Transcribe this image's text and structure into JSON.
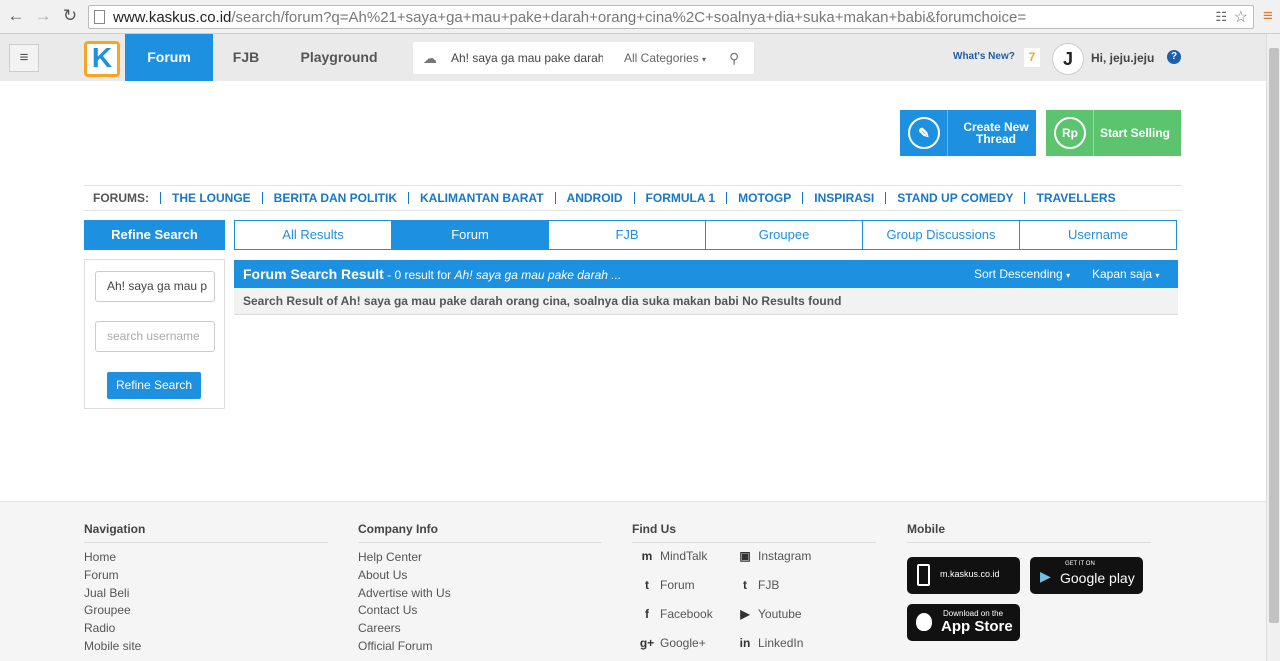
{
  "browser": {
    "url_host": "www.kaskus.co.id",
    "url_path": "/search/forum?q=Ah%21+saya+ga+mau+pake+darah+orang+cina%2C+soalnya+dia+suka+makan+babi&forumchoice="
  },
  "header": {
    "logo_letter": "K",
    "tabs": [
      "Forum",
      "FJB",
      "Playground"
    ],
    "search_value": "Ah! saya ga mau pake darah",
    "category": "All Categories",
    "whats_new": "What's New?",
    "notif_count": "7",
    "greeting": "Hi, jeju.jeju",
    "help": "?"
  },
  "actions": {
    "create_thread": "Create New Thread",
    "start_selling": "Start Selling",
    "rp": "Rp"
  },
  "forums": {
    "label": "FORUMS:",
    "items": [
      "THE LOUNGE",
      "BERITA DAN POLITIK",
      "KALIMANTAN BARAT",
      "ANDROID",
      "FORMULA 1",
      "MOTOGP",
      "INSPIRASI",
      "STAND UP COMEDY",
      "TRAVELLERS"
    ]
  },
  "refine": {
    "title": "Refine Search",
    "query_value": "Ah! saya ga mau p",
    "username_placeholder": "search username",
    "button": "Refine Search"
  },
  "tabs": [
    "All Results",
    "Forum",
    "FJB",
    "Groupee",
    "Group Discussions",
    "Username"
  ],
  "result": {
    "title": "Forum Search Result",
    "summary": " - 0 result for ",
    "query": "Ah! saya ga mau pake darah ...",
    "sort": "Sort Descending",
    "time": "Kapan saja",
    "message": "Search Result of Ah! saya ga mau pake darah orang cina, soalnya dia suka makan babi No Results found"
  },
  "footer": {
    "navigation": {
      "title": "Navigation",
      "links": [
        "Home",
        "Forum",
        "Jual Beli",
        "Groupee",
        "Radio",
        "Mobile site"
      ]
    },
    "company": {
      "title": "Company Info",
      "links": [
        "Help Center",
        "About Us",
        "Advertise with Us",
        "Contact Us",
        "Careers",
        "Official Forum"
      ]
    },
    "findus": {
      "title": "Find Us",
      "links": [
        "MindTalk",
        "Instagram",
        "Forum",
        "FJB",
        "Facebook",
        "Youtube",
        "Google+",
        "LinkedIn"
      ]
    },
    "mobile": {
      "title": "Mobile",
      "mkaskus": "m.kaskus.co.id",
      "gp_small": "GET IT ON",
      "gp_big": "Google play",
      "as_small": "Download on the",
      "as_big": "App Store"
    }
  }
}
